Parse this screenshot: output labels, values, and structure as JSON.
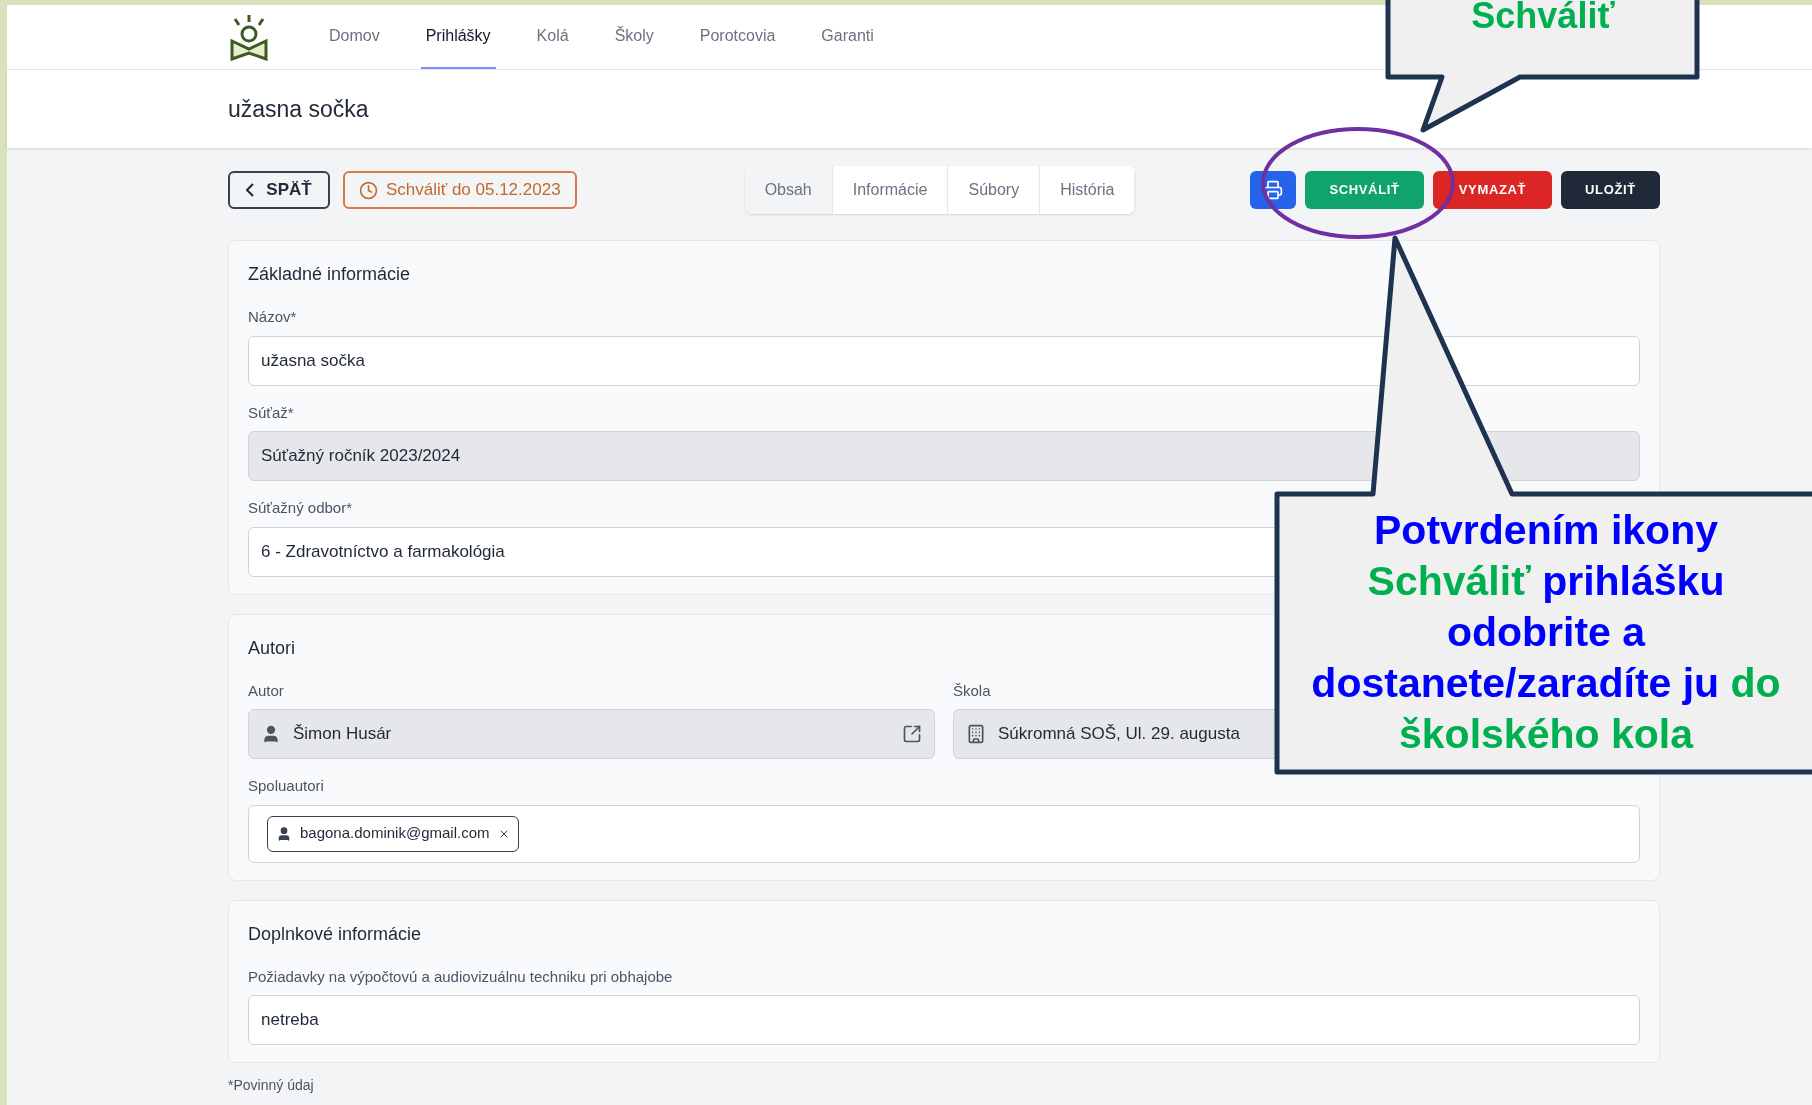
{
  "nav": {
    "items": [
      {
        "label": "Domov",
        "selected": false
      },
      {
        "label": "Prihlášky",
        "selected": true
      },
      {
        "label": "Kolá",
        "selected": false
      },
      {
        "label": "Školy",
        "selected": false
      },
      {
        "label": "Porotcovia",
        "selected": false
      },
      {
        "label": "Garanti",
        "selected": false
      }
    ]
  },
  "header": {
    "title": "užasna sočka"
  },
  "toolbar": {
    "back": "SPÄŤ",
    "deadline": "Schváliť do 05.12.2023",
    "tabs": [
      {
        "label": "Obsah",
        "selected": true
      },
      {
        "label": "Informácie",
        "selected": false
      },
      {
        "label": "Súbory",
        "selected": false
      },
      {
        "label": "História",
        "selected": false
      }
    ],
    "buttons": [
      {
        "kind": "print"
      },
      {
        "kind": "approve",
        "label": "SCHVÁLIŤ"
      },
      {
        "kind": "delete",
        "label": "VYMAZAŤ"
      },
      {
        "kind": "save",
        "label": "ULOŽIŤ"
      }
    ]
  },
  "sections": [
    {
      "title": "Základné informácie",
      "fields": [
        {
          "kind": "text",
          "label": "Názov*",
          "value": "užasna sočka",
          "disabled": false
        },
        {
          "kind": "text",
          "label": "Súťaž*",
          "value": "Súťažný ročník 2023/2024",
          "disabled": true
        },
        {
          "kind": "select",
          "label": "Súťažný odbor*",
          "value": "6 - Zdravotníctvo a farmakológia",
          "disabled": false
        }
      ]
    },
    {
      "title": "Autori",
      "fields": [
        {
          "kind": "person",
          "label": "Autor",
          "value": "Šimon Husár",
          "disabled": true
        },
        {
          "kind": "school",
          "label": "Škola",
          "value": "Súkromná SOŠ, Ul. 29. augusta",
          "disabled": true
        },
        {
          "kind": "tags",
          "label": "Spoluautori",
          "tags": [
            "bagona.dominik@gmail.com"
          ],
          "disabled": false
        }
      ]
    },
    {
      "title": "Doplnkové informácie",
      "fields": [
        {
          "kind": "text",
          "label": "Požiadavky na výpočtovú a audiovizuálnu techniku pri obhajobe",
          "value": "netreba",
          "disabled": false
        }
      ]
    }
  ],
  "footnote": "*Povinný údaj",
  "callouts": [
    {
      "segments": [
        {
          "text": "Schváliť",
          "color": "#00b050"
        }
      ]
    },
    {
      "segments": [
        {
          "text": "Potvrdením ikony",
          "color": "#0000ff",
          "line_break": true
        },
        {
          "text": "Schváliť ",
          "color": "#00b050",
          "line_break": false
        },
        {
          "text": "prihlášku",
          "color": "#0000ff",
          "line_break": true
        },
        {
          "text": "odobrite a",
          "color": "#0000ff",
          "line_break": true
        },
        {
          "text": "dostanete/zaradíte ju ",
          "color": "#0000ff",
          "line_break": false
        },
        {
          "text": "do",
          "color": "#00b050",
          "line_break": true
        },
        {
          "text": "školského kola",
          "color": "#00b050",
          "line_break": false
        }
      ]
    }
  ]
}
